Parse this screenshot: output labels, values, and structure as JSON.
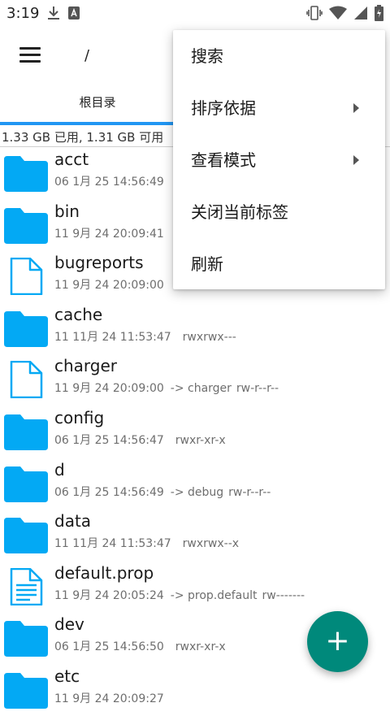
{
  "status_bar": {
    "time": "3:19",
    "left_icons": [
      "download-icon",
      "a-badge-icon"
    ],
    "right_icons": [
      "vibrate-icon",
      "wifi-icon",
      "signal-icon",
      "battery-icon"
    ]
  },
  "app_bar": {
    "path": "/"
  },
  "tabs": [
    {
      "label": "根目录",
      "selected": true
    }
  ],
  "storage": {
    "text": "1.33 GB 已用, 1.31 GB 可用"
  },
  "files": [
    {
      "name": "acct",
      "type": "folder",
      "date": "06 1月 25 14:56:49",
      "link": "",
      "perm": ""
    },
    {
      "name": "bin",
      "type": "folder",
      "date": "11 9月 24 20:09:41",
      "link": "",
      "perm": ""
    },
    {
      "name": "bugreports",
      "type": "file",
      "date": "11 9月 24 20:09:00",
      "link": "",
      "perm": ""
    },
    {
      "name": "cache",
      "type": "folder",
      "date": "11 11月 24 11:53:47",
      "link": "",
      "perm": "rwxrwx---"
    },
    {
      "name": "charger",
      "type": "file",
      "date": "11 9月 24 20:09:00",
      "link": "-> charger",
      "perm": "rw-r--r--"
    },
    {
      "name": "config",
      "type": "folder",
      "date": "06 1月 25 14:56:47",
      "link": "",
      "perm": "rwxr-xr-x"
    },
    {
      "name": "d",
      "type": "folder",
      "date": "06 1月 25 14:56:49",
      "link": "-> debug",
      "perm": "rw-r--r--"
    },
    {
      "name": "data",
      "type": "folder",
      "date": "11 11月 24 11:53:47",
      "link": "",
      "perm": "rwxrwx--x"
    },
    {
      "name": "default.prop",
      "type": "text-file",
      "date": "11 9月 24 20:05:24",
      "link": "-> prop.default",
      "perm": "rw-------"
    },
    {
      "name": "dev",
      "type": "folder",
      "date": "06 1月 25 14:56:50",
      "link": "",
      "perm": "rwxr-xr-x"
    },
    {
      "name": "etc",
      "type": "folder",
      "date": "11 9月 24 20:09:27",
      "link": "",
      "perm": ""
    }
  ],
  "popup_menu": {
    "items": [
      {
        "label": "搜索",
        "has_submenu": false
      },
      {
        "label": "排序依据",
        "has_submenu": true
      },
      {
        "label": "查看模式",
        "has_submenu": true
      },
      {
        "label": "关闭当前标签",
        "has_submenu": false
      },
      {
        "label": "刷新",
        "has_submenu": false
      }
    ]
  },
  "fab": {
    "icon": "plus-icon",
    "color": "#00897b"
  },
  "colors": {
    "folder": "#03a9f4",
    "tab_indicator": "#2196f3",
    "fab": "#00897b"
  }
}
